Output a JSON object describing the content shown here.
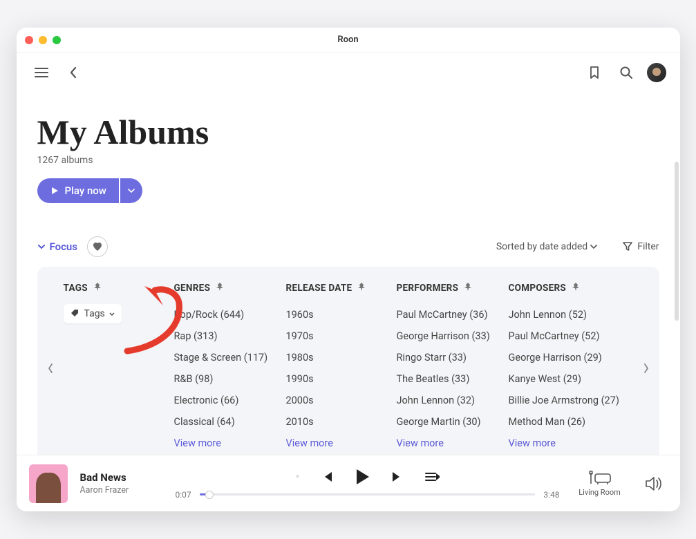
{
  "window": {
    "title": "Roon"
  },
  "page": {
    "title": "My Albums",
    "subtitle": "1267 albums"
  },
  "playButton": {
    "label": "Play now"
  },
  "focus": {
    "toggleLabel": "Focus",
    "sortLabel": "Sorted by date added",
    "filterLabel": "Filter"
  },
  "columns": {
    "tags": {
      "header": "TAGS",
      "chipLabel": "Tags"
    },
    "genres": {
      "header": "GENRES",
      "items": [
        "Pop/Rock (644)",
        "Rap (313)",
        "Stage & Screen (117)",
        "R&B (98)",
        "Electronic (66)",
        "Classical (64)"
      ],
      "more": "View more"
    },
    "release": {
      "header": "RELEASE DATE",
      "items": [
        "1960s",
        "1970s",
        "1980s",
        "1990s",
        "2000s",
        "2010s"
      ],
      "more": "View more"
    },
    "performers": {
      "header": "PERFORMERS",
      "items": [
        "Paul McCartney (36)",
        "George Harrison (33)",
        "Ringo Starr (33)",
        "The Beatles (33)",
        "John Lennon (32)",
        "George Martin (30)"
      ],
      "more": "View more"
    },
    "composers": {
      "header": "COMPOSERS",
      "items": [
        "John Lennon (52)",
        "Paul McCartney (52)",
        "George Harrison (29)",
        "Kanye West (29)",
        "Billie Joe Armstrong (27)",
        "Method Man (26)"
      ],
      "more": "View more"
    }
  },
  "player": {
    "trackTitle": "Bad News",
    "trackArtist": "Aaron Frazer",
    "elapsed": "0:07",
    "total": "3:48",
    "zone": "Living Room"
  }
}
